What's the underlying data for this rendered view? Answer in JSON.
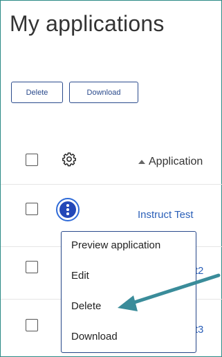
{
  "page": {
    "title": "My applications"
  },
  "toolbar": {
    "delete_label": "Delete",
    "download_label": "Download"
  },
  "table": {
    "column_header": "Application",
    "rows": [
      {
        "name": "Instruct Test"
      },
      {
        "name_visible_fragment": "est2"
      },
      {
        "name_visible_fragment": "est3"
      }
    ]
  },
  "context_menu": {
    "items": [
      "Preview application",
      "Edit",
      "Delete",
      "Download"
    ]
  },
  "colors": {
    "frame": "#2a8a86",
    "accent_blue": "#2348b8",
    "link_blue": "#2a5fb8",
    "annotation_arrow": "#3a8c9a"
  },
  "icons": [
    "gear-icon",
    "more-vertical-icon",
    "sort-ascending-icon",
    "annotation-arrow"
  ]
}
